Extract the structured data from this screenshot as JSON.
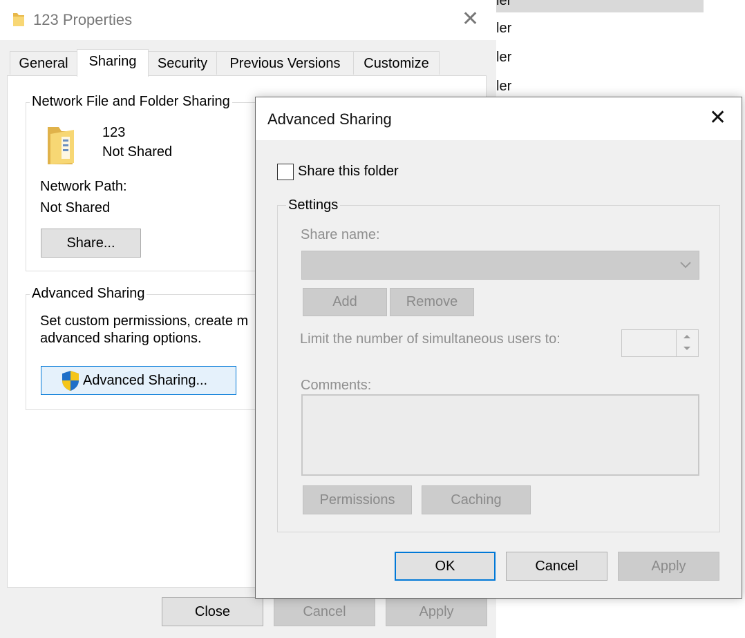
{
  "background_list": {
    "items": [
      "ler",
      "ler",
      "ler",
      "ler"
    ]
  },
  "properties": {
    "title": "123 Properties",
    "close_glyph": "✕",
    "tabs": [
      {
        "label": "General"
      },
      {
        "label": "Sharing"
      },
      {
        "label": "Security"
      },
      {
        "label": "Previous Versions"
      },
      {
        "label": "Customize"
      }
    ],
    "active_tab": "Sharing",
    "network_sharing": {
      "group_label": "Network File and Folder Sharing",
      "folder_name": "123",
      "share_status": "Not Shared",
      "network_path_label": "Network Path:",
      "network_path_value": "Not Shared",
      "share_button": "Share..."
    },
    "advanced_sharing_group": {
      "group_label": "Advanced Sharing",
      "description_line1": "Set custom permissions, create m",
      "description_line2": "advanced sharing options.",
      "button": "Advanced Sharing..."
    },
    "footer": {
      "close": "Close",
      "cancel": "Cancel",
      "apply": "Apply"
    }
  },
  "advanced_dialog": {
    "title": "Advanced Sharing",
    "close_glyph": "✕",
    "share_checkbox_label": "Share this folder",
    "share_checked": false,
    "settings_label": "Settings",
    "share_name_label": "Share name:",
    "add_button": "Add",
    "remove_button": "Remove",
    "limit_label": "Limit the number of simultaneous users to:",
    "comments_label": "Comments:",
    "permissions_button": "Permissions",
    "caching_button": "Caching",
    "ok_button": "OK",
    "cancel_button": "Cancel",
    "apply_button": "Apply"
  },
  "colors": {
    "accent": "#0078d7",
    "disabled_text": "#8f8f8f",
    "shield_blue": "#1e6fc8",
    "shield_yellow": "#f5c518"
  }
}
